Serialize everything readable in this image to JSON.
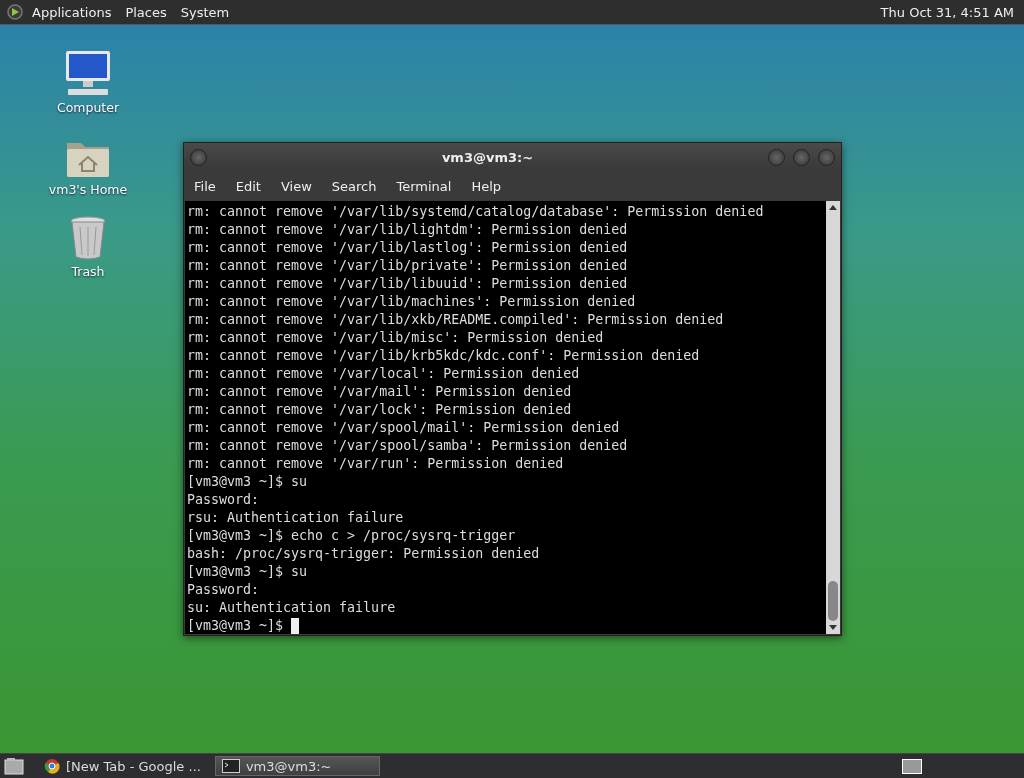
{
  "top_panel": {
    "menus": [
      "Applications",
      "Places",
      "System"
    ],
    "clock": "Thu Oct 31,  4:51 AM"
  },
  "desktop_icons": [
    {
      "kind": "computer",
      "label": "Computer"
    },
    {
      "kind": "home",
      "label": "vm3's Home"
    },
    {
      "kind": "trash",
      "label": "Trash"
    }
  ],
  "window": {
    "title": "vm3@vm3:~",
    "menu": [
      "File",
      "Edit",
      "View",
      "Search",
      "Terminal",
      "Help"
    ],
    "lines": [
      "rm: cannot remove '/var/lib/systemd/catalog/database': Permission denied",
      "rm: cannot remove '/var/lib/lightdm': Permission denied",
      "rm: cannot remove '/var/lib/lastlog': Permission denied",
      "rm: cannot remove '/var/lib/private': Permission denied",
      "rm: cannot remove '/var/lib/libuuid': Permission denied",
      "rm: cannot remove '/var/lib/machines': Permission denied",
      "rm: cannot remove '/var/lib/xkb/README.compiled': Permission denied",
      "rm: cannot remove '/var/lib/misc': Permission denied",
      "rm: cannot remove '/var/lib/krb5kdc/kdc.conf': Permission denied",
      "rm: cannot remove '/var/local': Permission denied",
      "rm: cannot remove '/var/mail': Permission denied",
      "rm: cannot remove '/var/lock': Permission denied",
      "rm: cannot remove '/var/spool/mail': Permission denied",
      "rm: cannot remove '/var/spool/samba': Permission denied",
      "rm: cannot remove '/var/run': Permission denied",
      "[vm3@vm3 ~]$ su",
      "Password:",
      "rsu: Authentication failure",
      "[vm3@vm3 ~]$ echo c > /proc/sysrq-trigger",
      "bash: /proc/sysrq-trigger: Permission denied",
      "[vm3@vm3 ~]$ su",
      "Password:",
      "su: Authentication failure",
      "[vm3@vm3 ~]$ "
    ]
  },
  "taskbar": [
    {
      "kind": "browser",
      "label": "[New Tab - Google ...",
      "selected": false
    },
    {
      "kind": "terminal",
      "label": "vm3@vm3:~",
      "selected": true
    }
  ]
}
